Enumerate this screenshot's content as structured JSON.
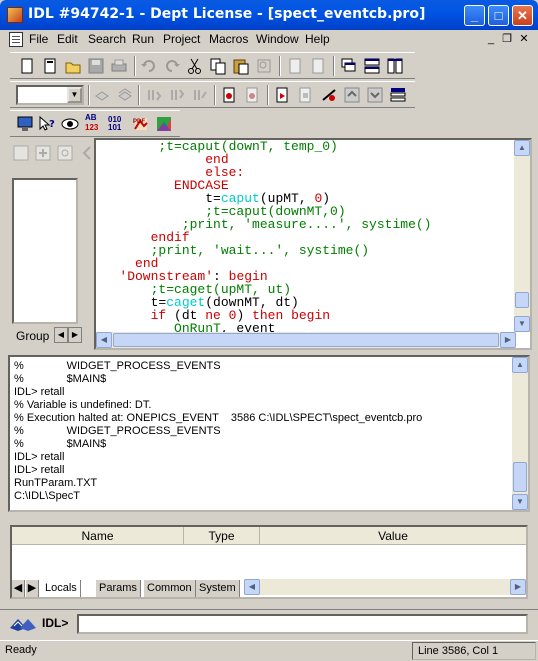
{
  "window": {
    "title": "IDL #94742-1 - Dept License - [spect_eventcb.pro]",
    "minimize_glyph": "_",
    "maximize_glyph": "□",
    "close_glyph": "✕"
  },
  "menu": {
    "items": [
      "File",
      "Edit",
      "Search",
      "Run",
      "Project",
      "Macros",
      "Window",
      "Help"
    ],
    "mdi_minimize": "_",
    "mdi_restore": "❐",
    "mdi_close": "✕"
  },
  "toolbar": {
    "icons_row1": [
      "new-file-icon",
      "new-doc-icon",
      "open-icon",
      "save-icon",
      "print-icon",
      "undo-icon",
      "redo-icon",
      "cut-icon",
      "copy-icon",
      "paste-icon",
      "find-icon",
      "indent-icon",
      "outdent-icon",
      "cascade-icon",
      "tile-horizontal-icon",
      "tile-vertical-icon"
    ],
    "icons_row2": [
      "compile-icon",
      "compile-all-icon",
      "step-into-icon",
      "step-over-icon",
      "step-out-icon",
      "breakpoint-icon",
      "clear-breakpoints-icon",
      "run-icon",
      "stop-icon",
      "reset-icon",
      "trace-up-icon",
      "trace-down-icon",
      "profile-icon"
    ],
    "icons_row3": [
      "monitor-icon",
      "help-cursor-icon",
      "eye-icon",
      "ab123-icon",
      "binary-icon",
      "pdf-icon",
      "palette-icon"
    ],
    "combo_value": "",
    "ab_text": "AB",
    "num_text": "123",
    "bin_text": "010 101",
    "pdf_text": "PDF"
  },
  "left_panel": {
    "group_label": "Group"
  },
  "editor": {
    "lines": [
      {
        "indent": "        ",
        "parts": [
          {
            "t": ";t=caput(downT, temp_0)",
            "c": "#007f00"
          }
        ]
      },
      {
        "indent": "              ",
        "parts": [
          {
            "t": "end",
            "c": "#cc0000"
          }
        ]
      },
      {
        "indent": "              ",
        "parts": [
          {
            "t": "else:",
            "c": "#cc0000"
          }
        ]
      },
      {
        "indent": "          ",
        "parts": [
          {
            "t": "ENDCASE",
            "c": "#cc0000"
          }
        ]
      },
      {
        "indent": "              ",
        "parts": [
          {
            "t": "t=",
            "c": "#000000"
          },
          {
            "t": "caput",
            "c": "#00cccc"
          },
          {
            "t": "(upMT, ",
            "c": "#000000"
          },
          {
            "t": "0",
            "c": "#cc0000"
          },
          {
            "t": ")",
            "c": "#000000"
          }
        ]
      },
      {
        "indent": "              ",
        "parts": [
          {
            "t": ";t=caput(downMT,0)",
            "c": "#007f00"
          }
        ]
      },
      {
        "indent": "           ",
        "parts": [
          {
            "t": ";print, 'measure....', systime()",
            "c": "#007f00"
          }
        ]
      },
      {
        "indent": "       ",
        "parts": [
          {
            "t": "endif",
            "c": "#cc0000"
          }
        ]
      },
      {
        "indent": "       ",
        "parts": [
          {
            "t": ";print, 'wait...', systime()",
            "c": "#007f00"
          }
        ]
      },
      {
        "indent": "     ",
        "parts": [
          {
            "t": "end",
            "c": "#cc0000"
          }
        ]
      },
      {
        "indent": "   ",
        "parts": [
          {
            "t": "'Downstream'",
            "c": "#cc0000"
          },
          {
            "t": ": ",
            "c": "#000000"
          },
          {
            "t": "begin",
            "c": "#cc0000"
          }
        ]
      },
      {
        "indent": "       ",
        "parts": [
          {
            "t": ";t=caget(upMT, ut)",
            "c": "#007f00"
          }
        ]
      },
      {
        "indent": "       ",
        "parts": [
          {
            "t": "t=",
            "c": "#000000"
          },
          {
            "t": "caget",
            "c": "#00cccc"
          },
          {
            "t": "(downMT, dt)",
            "c": "#000000"
          }
        ]
      },
      {
        "indent": "       ",
        "parts": [
          {
            "t": "if",
            "c": "#cc0000"
          },
          {
            "t": " (dt ",
            "c": "#000000"
          },
          {
            "t": "ne",
            "c": "#cc0000"
          },
          {
            "t": " ",
            "c": "#000000"
          },
          {
            "t": "0",
            "c": "#cc0000"
          },
          {
            "t": ") ",
            "c": "#000000"
          },
          {
            "t": "then begin",
            "c": "#cc0000"
          }
        ]
      },
      {
        "indent": "          ",
        "parts": [
          {
            "t": "OnRunT",
            "c": "#007f00"
          },
          {
            "t": ", event",
            "c": "#000000"
          }
        ]
      }
    ]
  },
  "output": {
    "lines": [
      "%              WIDGET_PROCESS_EVENTS",
      "%              $MAIN$",
      "IDL> retall",
      "% Variable is undefined: DT.",
      "% Execution halted at: ONEPICS_EVENT    3586 C:\\IDL\\SPECT\\spect_eventcb.pro",
      "%              WIDGET_PROCESS_EVENTS",
      "%              $MAIN$",
      "IDL> retall",
      "IDL> retall",
      "RunTParam.TXT",
      "C:\\IDL\\SpecT"
    ]
  },
  "variables": {
    "columns": [
      "Name",
      "Type",
      "Value"
    ],
    "tabs": [
      "Locals",
      "Params",
      "Common",
      "System"
    ],
    "active_tab": "Locals"
  },
  "command": {
    "prompt": "IDL>",
    "value": ""
  },
  "status": {
    "left": "Ready",
    "position": "Line 3586, Col 1"
  },
  "scroll_arrows": {
    "up": "▲",
    "down": "▼",
    "left": "◀",
    "right": "▶"
  }
}
